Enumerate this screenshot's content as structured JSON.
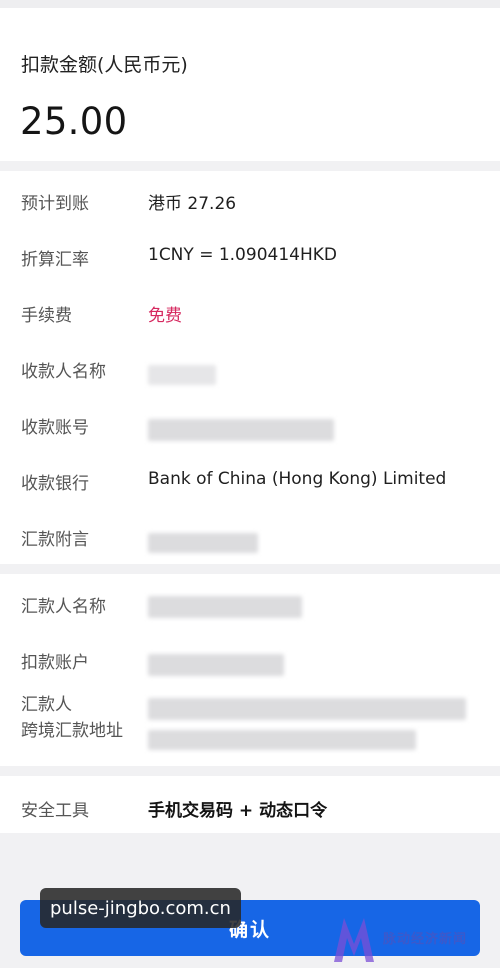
{
  "amount": {
    "label": "扣款金额(人民币元)",
    "value": "25.00"
  },
  "details": [
    {
      "label": "预计到账",
      "value": "港币 27.26"
    },
    {
      "label": "折算汇率",
      "value": "1CNY = 1.090414HKD"
    },
    {
      "label": "手续费",
      "value": "免费"
    },
    {
      "label": "收款人名称",
      "value": ""
    },
    {
      "label": "收款账号",
      "value": ""
    },
    {
      "label": "收款银行",
      "value": "Bank of China (Hong Kong) Limited"
    },
    {
      "label": "汇款附言",
      "value": ""
    }
  ],
  "payer": {
    "name_label": "汇款人名称",
    "account_label": "扣款账户",
    "address_label_line1": "汇款人",
    "address_label_line2": "跨境汇款地址"
  },
  "security": {
    "label": "安全工具",
    "value": "手机交易码 + 动态口令"
  },
  "confirm_label": "确认",
  "watermark": {
    "url": "pulse-jingbo.com.cn",
    "brand": "脉动经济新闻"
  },
  "colors": {
    "accent": "#1766e6",
    "free_text": "#d6285f"
  }
}
